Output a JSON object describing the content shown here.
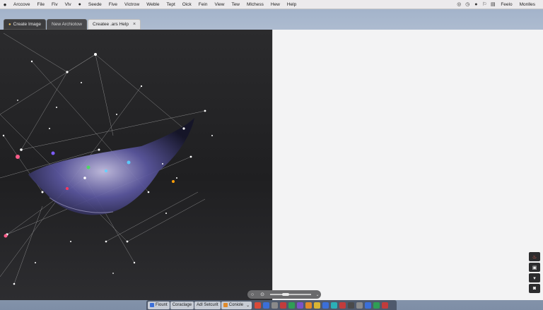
{
  "menubar": {
    "apple_icon": "apple-icon",
    "items": [
      "Arccove",
      "File",
      "Fiv",
      "Vlv",
      "Seede",
      "Five",
      "Victrow",
      "Weble",
      "Tept",
      "Oick",
      "Fein",
      "View",
      "Tew",
      "Mlchess",
      "Hew",
      "Help"
    ],
    "status_icons": [
      "siri-icon",
      "clock-icon",
      "sound-icon",
      "flag-icon",
      "window-icon"
    ],
    "status_texts": [
      "Feelo",
      "Monlles"
    ]
  },
  "tabs": [
    {
      "label": "Create Image",
      "icon": "lock-icon",
      "state": "inactive"
    },
    {
      "label": "New Archiotow",
      "state": "inactive"
    },
    {
      "label": "Createe .ars Help",
      "state": "active",
      "close": "×"
    }
  ],
  "canvas_tools": {
    "buttons": [
      "fit-icon",
      "zoom-icon"
    ],
    "chevron": "⌄"
  },
  "side_tools": [
    "flame-icon",
    "save-icon",
    "collapse-icon",
    "export-icon"
  ],
  "dock": {
    "buttons": [
      "Fiount",
      "Coraclage",
      "Adl Setcurit",
      "Coniole"
    ],
    "chevron": "⌄",
    "app_colors": [
      "#d84a3a",
      "#3b6fd8",
      "#8a8a8a",
      "#c23c3c",
      "#2f9e55",
      "#7a52c8",
      "#e08a2a",
      "#d8b534",
      "#3b6fd8",
      "#2bb0b8",
      "#c23c3c",
      "#4a4a4a",
      "#8a8a8a",
      "#3b6fd8",
      "#2f9e55",
      "#c23c3c"
    ]
  }
}
